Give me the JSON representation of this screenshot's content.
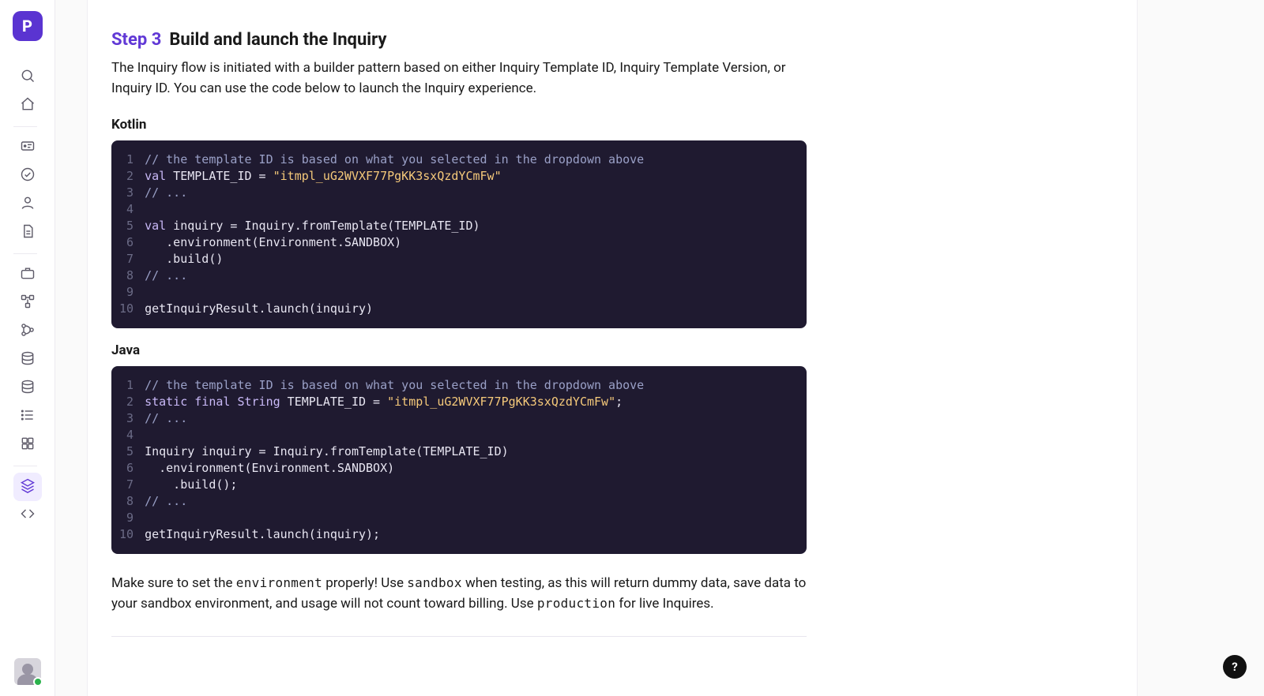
{
  "sidebar": {
    "logo_letter": "P",
    "items": [
      {
        "id": "search",
        "icon": "search"
      },
      {
        "id": "home",
        "icon": "home",
        "divider_after": true
      },
      {
        "id": "card",
        "icon": "card"
      },
      {
        "id": "check",
        "icon": "check-circle"
      },
      {
        "id": "user",
        "icon": "user"
      },
      {
        "id": "doc",
        "icon": "document",
        "divider_after": true
      },
      {
        "id": "briefcase",
        "icon": "briefcase"
      },
      {
        "id": "nodes",
        "icon": "nodes"
      },
      {
        "id": "branch",
        "icon": "branch"
      },
      {
        "id": "db1",
        "icon": "database"
      },
      {
        "id": "db2",
        "icon": "database"
      },
      {
        "id": "list",
        "icon": "list"
      },
      {
        "id": "apps",
        "icon": "grid",
        "divider_after": true
      },
      {
        "id": "layers",
        "icon": "layers",
        "active": true
      },
      {
        "id": "code",
        "icon": "code"
      }
    ]
  },
  "main": {
    "step_tag": "Step 3",
    "step_title": "Build and launch the Inquiry",
    "lead": "The Inquiry flow is initiated with a builder pattern based on either Inquiry Template ID, Inquiry Template Version, or Inquiry ID. You can use the code below to launch the Inquiry experience.",
    "blocks": [
      {
        "lang": "Kotlin",
        "lines": [
          [
            {
              "cls": "c-cmt",
              "t": "// the template ID is based on what you selected in the dropdown above"
            }
          ],
          [
            {
              "cls": "c-kw",
              "t": "val"
            },
            {
              "cls": "",
              "t": " TEMPLATE_ID = "
            },
            {
              "cls": "c-str",
              "t": "\"itmpl_uG2WVXF77PgKK3sxQzdYCmFw\""
            }
          ],
          [
            {
              "cls": "c-cmt",
              "t": "// ..."
            }
          ],
          [
            {
              "cls": "",
              "t": ""
            }
          ],
          [
            {
              "cls": "c-kw",
              "t": "val"
            },
            {
              "cls": "",
              "t": " inquiry = Inquiry.fromTemplate(TEMPLATE_ID)"
            }
          ],
          [
            {
              "cls": "",
              "t": "   .environment(Environment.SANDBOX)"
            }
          ],
          [
            {
              "cls": "",
              "t": "   .build()"
            }
          ],
          [
            {
              "cls": "c-cmt",
              "t": "// ..."
            }
          ],
          [
            {
              "cls": "",
              "t": ""
            }
          ],
          [
            {
              "cls": "",
              "t": "getInquiryResult.launch(inquiry)"
            }
          ]
        ]
      },
      {
        "lang": "Java",
        "lines": [
          [
            {
              "cls": "c-cmt",
              "t": "// the template ID is based on what you selected in the dropdown above"
            }
          ],
          [
            {
              "cls": "c-kw",
              "t": "static final"
            },
            {
              "cls": "",
              "t": " "
            },
            {
              "cls": "c-typ",
              "t": "String"
            },
            {
              "cls": "",
              "t": " TEMPLATE_ID = "
            },
            {
              "cls": "c-str",
              "t": "\"itmpl_uG2WVXF77PgKK3sxQzdYCmFw\""
            },
            {
              "cls": "",
              "t": ";"
            }
          ],
          [
            {
              "cls": "c-cmt",
              "t": "// ..."
            }
          ],
          [
            {
              "cls": "",
              "t": ""
            }
          ],
          [
            {
              "cls": "",
              "t": "Inquiry inquiry = Inquiry.fromTemplate(TEMPLATE_ID)"
            }
          ],
          [
            {
              "cls": "",
              "t": "  .environment(Environment.SANDBOX)"
            }
          ],
          [
            {
              "cls": "",
              "t": "    .build();"
            }
          ],
          [
            {
              "cls": "c-cmt",
              "t": "// ..."
            }
          ],
          [
            {
              "cls": "",
              "t": ""
            }
          ],
          [
            {
              "cls": "",
              "t": "getInquiryResult.launch(inquiry);"
            }
          ]
        ]
      }
    ],
    "note_parts": {
      "p1": "Make sure to set the ",
      "c1": "environment",
      "p2": " properly! Use ",
      "c2": "sandbox",
      "p3": " when testing, as this will return dummy data, save data to your sandbox environment, and usage will not count toward billing. Use ",
      "c3": "production",
      "p4": " for live Inquires."
    }
  },
  "help_label": "?"
}
